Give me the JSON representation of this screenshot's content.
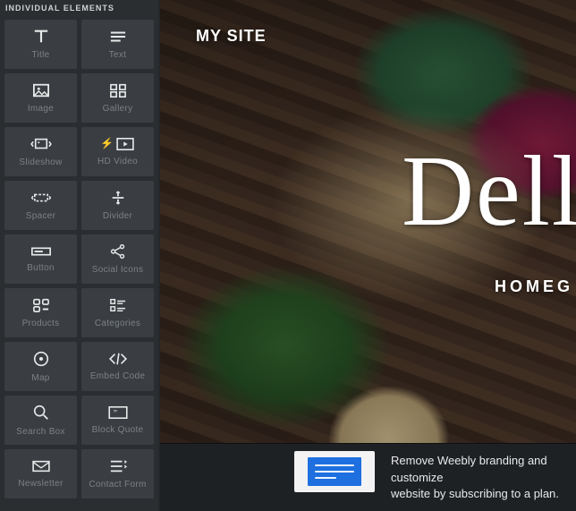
{
  "sidebar": {
    "header": "INDIVIDUAL ELEMENTS",
    "items": [
      {
        "label": "Title",
        "icon": "title-icon"
      },
      {
        "label": "Text",
        "icon": "text-icon"
      },
      {
        "label": "Image",
        "icon": "image-icon"
      },
      {
        "label": "Gallery",
        "icon": "gallery-icon"
      },
      {
        "label": "Slideshow",
        "icon": "slideshow-icon"
      },
      {
        "label": "HD Video",
        "icon": "hd-video-icon",
        "bolt": true
      },
      {
        "label": "Spacer",
        "icon": "spacer-icon"
      },
      {
        "label": "Divider",
        "icon": "divider-icon"
      },
      {
        "label": "Button",
        "icon": "button-icon"
      },
      {
        "label": "Social Icons",
        "icon": "social-icons-icon"
      },
      {
        "label": "Products",
        "icon": "products-icon"
      },
      {
        "label": "Categories",
        "icon": "categories-icon"
      },
      {
        "label": "Map",
        "icon": "map-icon"
      },
      {
        "label": "Embed Code",
        "icon": "embed-code-icon"
      },
      {
        "label": "Search Box",
        "icon": "search-box-icon"
      },
      {
        "label": "Block Quote",
        "icon": "block-quote-icon"
      },
      {
        "label": "Newsletter",
        "icon": "newsletter-icon"
      },
      {
        "label": "Contact Form",
        "icon": "contact-form-icon"
      }
    ]
  },
  "canvas": {
    "site_title": "MY SITE",
    "headline": "Dell",
    "subheadline": "HOMEG"
  },
  "banner": {
    "line1": "Remove Weebly branding and customize",
    "line2": "website by subscribing to a plan."
  },
  "colors": {
    "sidebar_bg": "#2b2e31",
    "tile_bg": "#3a3e42",
    "tile_label": "#7d8185",
    "bolt": "#f9a825",
    "banner_bg": "#1e2124",
    "accent_blue": "#1e6fe0"
  }
}
